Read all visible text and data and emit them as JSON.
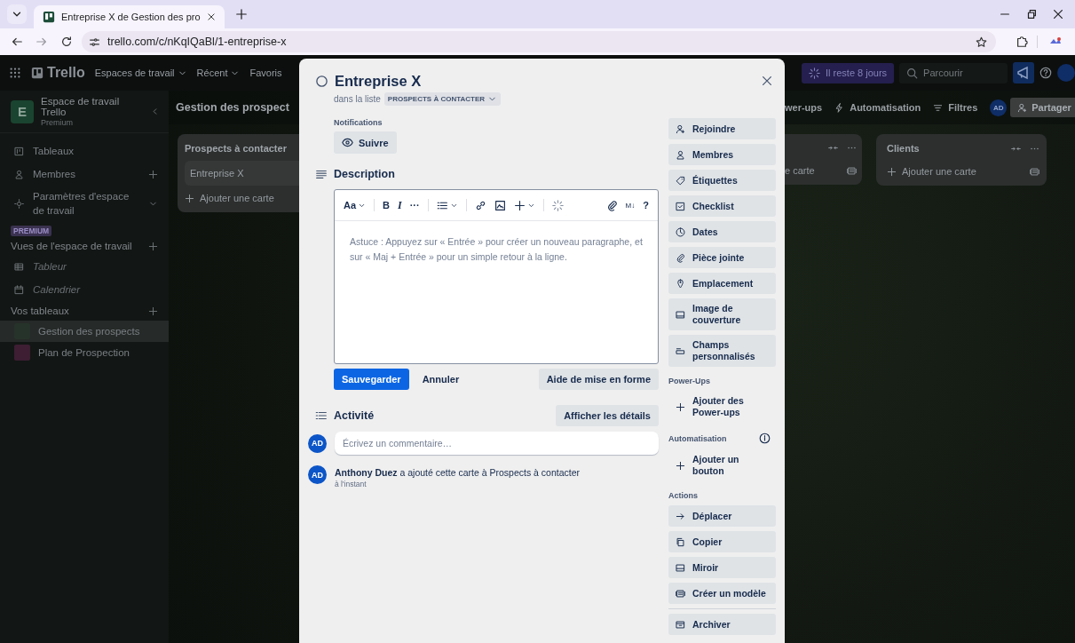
{
  "browser": {
    "tab_title": "Entreprise X de Gestion des pro",
    "url": "trello.com/c/nKqIQaBl/1-entreprise-x"
  },
  "header": {
    "logo": "Trello",
    "menus": [
      "Espaces de travail",
      "Récent",
      "Favoris"
    ],
    "trial": "Il reste 8 jours",
    "search": {
      "placeholder": "Parcourir"
    }
  },
  "sidebar": {
    "workspace": {
      "initial": "E",
      "name": "Espace de travail Trello",
      "plan": "Premium"
    },
    "nav": [
      {
        "label": "Tableaux",
        "kind": "link"
      },
      {
        "label": "Membres",
        "kind": "add"
      },
      {
        "label": "Paramètres d'espace de travail",
        "kind": "expand"
      }
    ],
    "premium_badge": "PREMIUM",
    "views": {
      "title": "Vues de l'espace de travail",
      "items": [
        "Tableur",
        "Calendrier"
      ]
    },
    "boards": {
      "title": "Vos tableaux",
      "items": [
        {
          "label": "Gestion des prospects",
          "selected": true,
          "color": "#26332a"
        },
        {
          "label": "Plan de Prospection",
          "selected": false,
          "color": "#3d1e33"
        }
      ]
    }
  },
  "board": {
    "title": "Gestion des prospect",
    "toolbar": [
      "wer-ups",
      "Automatisation",
      "Filtres"
    ],
    "member": "AD",
    "share": "Partager",
    "lists": [
      {
        "title": "Prospects à contacter",
        "cards": [
          "Entreprise X"
        ],
        "add": "Ajouter une carte"
      },
      {
        "add": "e carte"
      },
      {
        "title": "Clients",
        "add": "Ajouter une carte"
      }
    ]
  },
  "card": {
    "title": "Entreprise X",
    "list_prefix": "dans la liste",
    "list_name": "PROSPECTS À CONTACTER",
    "notifications": {
      "label": "Notifications",
      "button": "Suivre"
    },
    "description": {
      "title": "Description",
      "toolbar": {
        "format": "Aa",
        "bold": "B",
        "italic": "I",
        "more": "···",
        "markdown": "M↓",
        "help": "?"
      },
      "placeholder": "Astuce : Appuyez sur « Entrée » pour créer un nouveau paragraphe, et sur « Maj + Entrée » pour un simple retour à la ligne.",
      "save": "Sauvegarder",
      "cancel": "Annuler",
      "help": "Aide de mise en forme"
    },
    "activity": {
      "title": "Activité",
      "details": "Afficher les détails",
      "comment": {
        "avatar": "AD",
        "placeholder": "Écrivez un commentaire…"
      },
      "entries": [
        {
          "avatar": "AD",
          "text": "**Anthony Duez** a ajouté cette carte à Prospects à contacter",
          "time": "à l'instant"
        }
      ]
    },
    "side_sections": [
      {
        "items": [
          {
            "label": "Rejoindre",
            "kind": "button"
          },
          {
            "label": "Membres",
            "kind": "button"
          },
          {
            "label": "Étiquettes",
            "kind": "button"
          },
          {
            "label": "Checklist",
            "kind": "button"
          },
          {
            "label": "Dates",
            "kind": "button"
          },
          {
            "label": "Pièce jointe",
            "kind": "button"
          },
          {
            "label": "Emplacement",
            "kind": "button"
          },
          {
            "label": "Image de couverture",
            "kind": "button"
          },
          {
            "label": "Champs personnalisés",
            "kind": "button"
          }
        ]
      },
      {
        "title": "Power-Ups",
        "items": [
          {
            "label": "Ajouter des Power-ups",
            "kind": "add"
          }
        ]
      },
      {
        "title": "Automatisation",
        "items": [
          {
            "label": "Ajouter un bouton",
            "kind": "add"
          }
        ]
      },
      {
        "title": "Actions",
        "items": [
          {
            "label": "Déplacer",
            "kind": "button"
          },
          {
            "label": "Copier",
            "kind": "button"
          },
          {
            "label": "Miroir",
            "kind": "button"
          },
          {
            "label": "Créer un modèle",
            "kind": "button"
          },
          {
            "label": "Archiver",
            "kind": "button"
          }
        ]
      }
    ]
  }
}
